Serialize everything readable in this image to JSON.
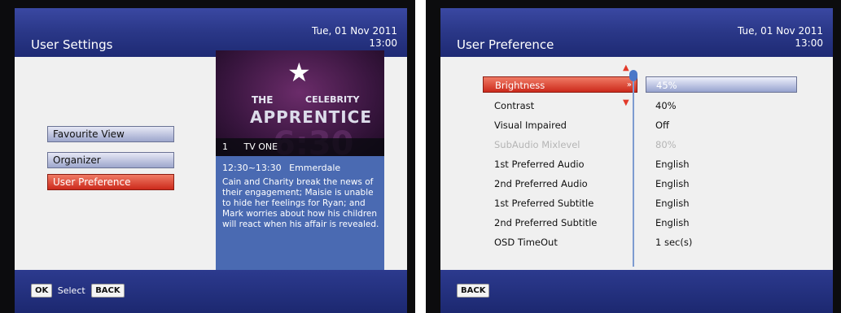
{
  "left_screen": {
    "header": {
      "title": "User Settings",
      "date": "Tue, 01 Nov 2011",
      "time": "13:00"
    },
    "menu": [
      {
        "label": "Favourite View",
        "active": false
      },
      {
        "label": "Organizer",
        "active": false
      },
      {
        "label": "User Preference",
        "active": true
      }
    ],
    "preview": {
      "poster_text_1": "THE",
      "poster_text_2": "CELEBRITY",
      "poster_text_3": "APPRENTICE",
      "poster_bignum": "6:30",
      "channel_number": "1",
      "channel_name": "TV ONE",
      "programme_time": "12:30~13:30",
      "programme_title": "Emmerdale",
      "description": "Cain and Charity break the news of their engagement; Maisie is unable to hide her feelings for Ryan; and Mark worries about how his children will react when his affair is revealed."
    },
    "footer": {
      "ok_key": "OK",
      "select_label": "Select",
      "back_key": "BACK"
    }
  },
  "right_screen": {
    "header": {
      "title": "User Preference",
      "date": "Tue, 01 Nov 2011",
      "time": "13:00"
    },
    "preferences": [
      {
        "label": "Brightness",
        "value": "45%",
        "state": "active"
      },
      {
        "label": "Contrast",
        "value": "40%",
        "state": "normal"
      },
      {
        "label": "Visual Impaired",
        "value": "Off",
        "state": "normal"
      },
      {
        "label": "SubAudio Mixlevel",
        "value": "80%",
        "state": "disabled"
      },
      {
        "label": "1st Preferred Audio",
        "value": "English",
        "state": "normal"
      },
      {
        "label": "2nd Preferred Audio",
        "value": "English",
        "state": "normal"
      },
      {
        "label": "1st Preferred Subtitle",
        "value": "English",
        "state": "normal"
      },
      {
        "label": "2nd Preferred Subtitle",
        "value": "English",
        "state": "normal"
      },
      {
        "label": "OSD TimeOut",
        "value": "1 sec(s)",
        "state": "normal"
      }
    ],
    "footer": {
      "back_key": "BACK"
    }
  },
  "icons": {
    "chevron_right": "double-chevron-right-icon",
    "arrow_up": "arrow-up-icon",
    "arrow_down": "arrow-down-icon"
  },
  "colors": {
    "header_blue": "#2a3787",
    "active_red": "#cc2a1c",
    "preview_blue": "#4a6ab2"
  }
}
